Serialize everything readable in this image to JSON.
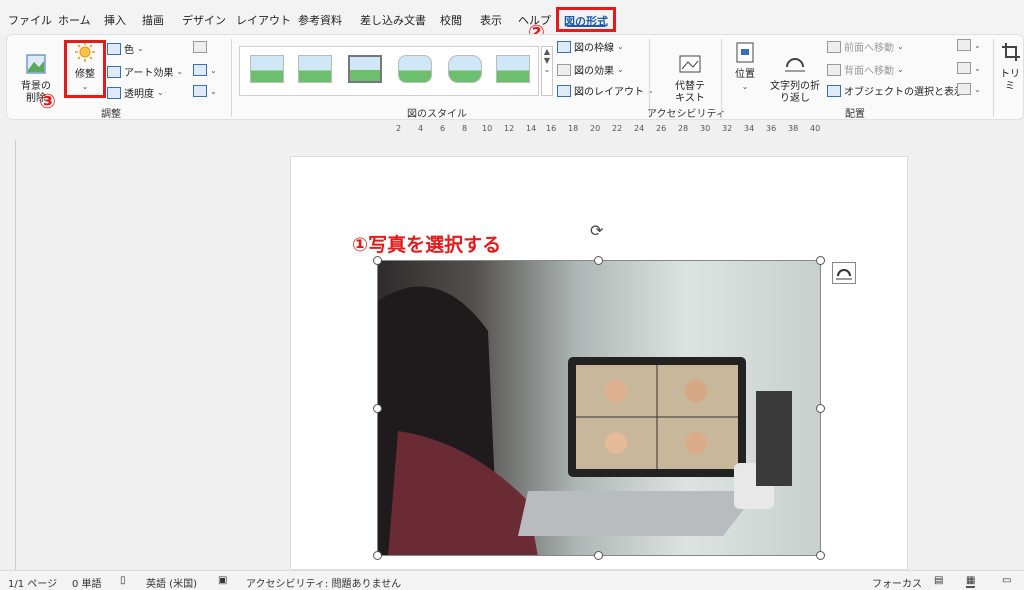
{
  "tabs": [
    "ファイル",
    "ホーム",
    "挿入",
    "描画",
    "デザイン",
    "レイアウト",
    "参考資料",
    "差し込み文書",
    "校閲",
    "表示",
    "ヘルプ"
  ],
  "active_tab": "図の形式",
  "ribbon": {
    "remove_bg": "背景の\n削除",
    "corrections": "修整",
    "color": "色",
    "art_effects": "アート効果",
    "transparency": "透明度",
    "group_adjust": "調整",
    "group_styles": "図のスタイル",
    "border": "図の枠線",
    "effects": "図の効果",
    "layout": "図のレイアウト",
    "alt_text": "代替テ\nキスト",
    "group_accessibility": "アクセシビリティ",
    "position": "位置",
    "wrap_text": "文字列の折\nり返し",
    "bring_forward": "前面へ移動",
    "send_backward": "背面へ移動",
    "selection_pane": "オブジェクトの選択と表示",
    "group_arrange": "配置",
    "crop": "トリミ"
  },
  "callouts": {
    "one": "①写真を選択する",
    "two": "②",
    "three": "③"
  },
  "ruler_ticks": [
    "2",
    "4",
    "6",
    "8",
    "10",
    "12",
    "14",
    "16",
    "18",
    "20",
    "22",
    "24",
    "26",
    "28",
    "30",
    "32",
    "34",
    "36",
    "38",
    "40"
  ],
  "status": {
    "page": "1/1 ページ",
    "words": "0 単語",
    "language": "英語 (米国)",
    "accessibility": "アクセシビリティ: 問題ありません",
    "focus": "フォーカス"
  },
  "colors": {
    "accent_red": "#e51a1a",
    "active_blue": "#1e5aa8"
  }
}
